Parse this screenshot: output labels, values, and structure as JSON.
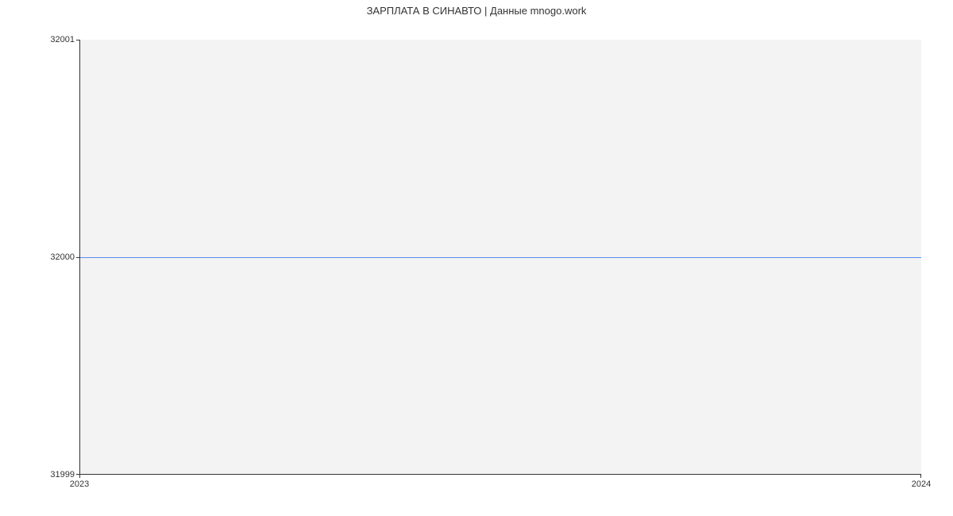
{
  "chart_data": {
    "type": "line",
    "title": "ЗАРПЛАТА В СИНАВТО | Данные mnogo.work",
    "x": [
      2023,
      2024
    ],
    "values": [
      32000,
      32000
    ],
    "y_ticks": [
      31999,
      32000,
      32001
    ],
    "x_ticks": [
      2023,
      2024
    ],
    "ylim": [
      31999,
      32001
    ],
    "xlim": [
      2023,
      2024
    ],
    "line_color": "#5b8def",
    "plot_bg": "#f3f3f3",
    "xlabel": "",
    "ylabel": ""
  }
}
